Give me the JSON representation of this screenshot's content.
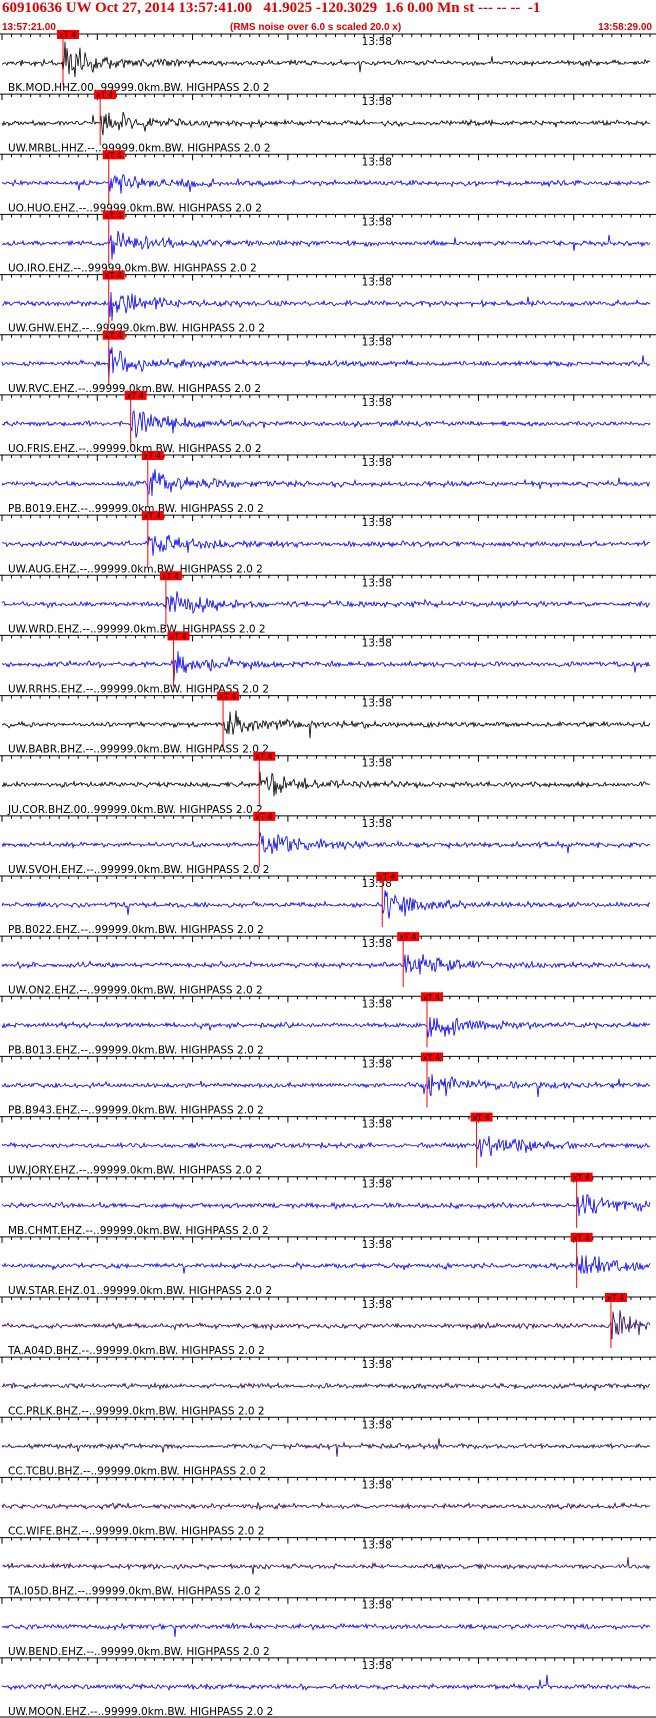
{
  "header": {
    "title": "60910636 UW Oct 27, 2014 13:57:41.00   41.9025 -120.3029  1.6 0.00 Mn st --- -- --  -1",
    "start_time": "13:57:21.00",
    "scaling_note": "(RMS noise over 6.0 s scaled 20.0 x)",
    "end_time": "13:58:29.00"
  },
  "chart_data": {
    "type": "line",
    "title": "60910636 UW Oct 27, 2014 13:57:41.00   41.9025 -120.3029  1.6 0.00 Mn st --- -- --  -1",
    "x_start": "13:57:21.00",
    "x_end": "13:58:29.00",
    "x_tick_label": "13:58",
    "x_tick_time": "13:58:00",
    "pick_label": "xT 4",
    "grid": true,
    "colors": {
      "blue_trace": "#0000ff",
      "dark_trace": "#000000",
      "purple_trace": "#2a0060",
      "pick": "#ff0000",
      "grid": "#000000"
    },
    "series": [
      {
        "name": "BK.MOD.HHZ.00..99999.0km.BW. HIGHPASS  2.0  2",
        "color": "dark_trace",
        "pick_time": "13:57:27.4"
      },
      {
        "name": "UW.MRBL.HHZ.--..99999.0km.BW. HIGHPASS  2.0  2",
        "color": "dark_trace",
        "pick_time": "13:57:31.3"
      },
      {
        "name": "UO.HUO.EHZ.--..99999.0km.BW. HIGHPASS  2.0  2",
        "color": "blue_trace",
        "pick_time": "13:57:32.2"
      },
      {
        "name": "UO.IRO.EHZ.--..99999.0km.BW. HIGHPASS  2.0  2",
        "color": "blue_trace",
        "pick_time": "13:57:32.2"
      },
      {
        "name": "UW.GHW.EHZ.--..99999.0km.BW. HIGHPASS  2.0  2",
        "color": "blue_trace",
        "pick_time": "13:57:32.2"
      },
      {
        "name": "UW.RVC.EHZ.--..99999.0km.BW. HIGHPASS  2.0  2",
        "color": "blue_trace",
        "pick_time": "13:57:32.2"
      },
      {
        "name": "UO.FRIS.EHZ.--..99999.0km.BW. HIGHPASS  2.0  2",
        "color": "blue_trace",
        "pick_time": "13:57:34.5"
      },
      {
        "name": "PB.B019.EHZ.--..99999.0km.BW. HIGHPASS  2.0  2",
        "color": "blue_trace",
        "pick_time": "13:57:36.3"
      },
      {
        "name": "UW.AUG.EHZ.--..99999.0km.BW. HIGHPASS  2.0  2",
        "color": "blue_trace",
        "pick_time": "13:57:36.3"
      },
      {
        "name": "UW.WRD.EHZ.--..99999.0km.BW. HIGHPASS  2.0  2",
        "color": "blue_trace",
        "pick_time": "13:57:38.2"
      },
      {
        "name": "UW.RRHS.EHZ.--..99999.0km.BW. HIGHPASS  2.0  2",
        "color": "blue_trace",
        "pick_time": "13:57:39.0"
      },
      {
        "name": "UW.BABR.BHZ.--..99999.0km.BW. HIGHPASS  2.0  2",
        "color": "dark_trace",
        "pick_time": "13:57:44.2"
      },
      {
        "name": "JU.COR.BHZ.00..99999.0km.BW. HIGHPASS  2.0  2",
        "color": "dark_trace",
        "pick_time": "13:57:48.0"
      },
      {
        "name": "UW.SVOH.EHZ.--..99999.0km.BW. HIGHPASS  2.0  2",
        "color": "blue_trace",
        "pick_time": "13:57:48.0"
      },
      {
        "name": "PB.B022.EHZ.--..99999.0km.BW. HIGHPASS  2.0  2",
        "color": "blue_trace",
        "pick_time": "13:58:00.9"
      },
      {
        "name": "UW.ON2.EHZ.--..99999.0km.BW. HIGHPASS  2.0  2",
        "color": "blue_trace",
        "pick_time": "13:58:03.1"
      },
      {
        "name": "PB.B013.EHZ.--..99999.0km.BW. HIGHPASS  2.0  2",
        "color": "blue_trace",
        "pick_time": "13:58:05.6"
      },
      {
        "name": "PB.B943.EHZ.--..99999.0km.BW. HIGHPASS  2.0  2",
        "color": "blue_trace",
        "pick_time": "13:58:05.6"
      },
      {
        "name": "UW.JORY.EHZ.--..99999.0km.BW. HIGHPASS  2.0  2",
        "color": "blue_trace",
        "pick_time": "13:58:10.8"
      },
      {
        "name": "MB.CHMT.EHZ.--..99999.0km.BW. HIGHPASS  2.0  2",
        "color": "blue_trace",
        "pick_time": "13:58:21.3"
      },
      {
        "name": "UW.STAR.EHZ.01..99999.0km.BW. HIGHPASS  2.0  2",
        "color": "blue_trace",
        "pick_time": "13:58:21.3"
      },
      {
        "name": "TA.A04D.BHZ.--..99999.0km.BW. HIGHPASS  2.0  2",
        "color": "purple_trace",
        "pick_time": "13:58:24.9"
      },
      {
        "name": "CC.PRLK.BHZ.--..99999.0km.BW. HIGHPASS  2.0  2",
        "color": "purple_trace",
        "pick_time": null
      },
      {
        "name": "CC.TCBU.BHZ.--..99999.0km.BW. HIGHPASS  2.0  2",
        "color": "purple_trace",
        "pick_time": null
      },
      {
        "name": "CC.WIFE.BHZ.--..99999.0km.BW. HIGHPASS  2.0  2",
        "color": "purple_trace",
        "pick_time": null
      },
      {
        "name": "TA.I05D.BHZ.--..99999.0km.BW. HIGHPASS  2.0  2",
        "color": "purple_trace",
        "pick_time": null
      },
      {
        "name": "UW.BEND.EHZ.--..99999.0km.BW. HIGHPASS  2.0  2",
        "color": "blue_trace",
        "pick_time": null
      },
      {
        "name": "UW.MOON.EHZ.--..99999.0km.BW. HIGHPASS  2.0  2",
        "color": "blue_trace",
        "pick_time": null
      }
    ]
  }
}
